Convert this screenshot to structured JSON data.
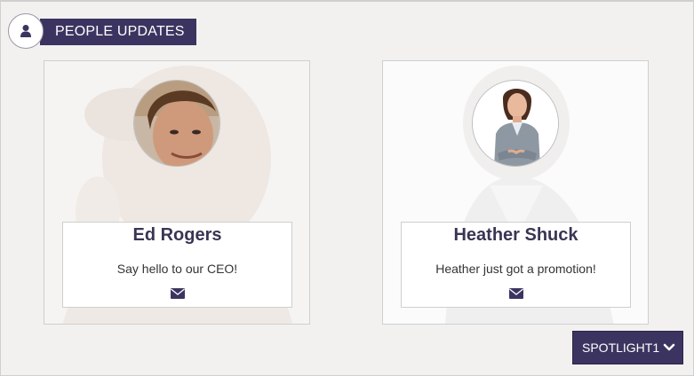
{
  "header": {
    "icon": "user-icon",
    "title": "PEOPLE UPDATES"
  },
  "cards": [
    {
      "name": "Ed Rogers",
      "message": "Say hello to our CEO!",
      "icon": "envelope-icon"
    },
    {
      "name": "Heather Shuck",
      "message": "Heather just got a promotion!",
      "icon": "envelope-icon"
    }
  ],
  "spotlight": {
    "label": "SPOTLIGHT1",
    "icon": "chevron-down-icon"
  },
  "colors": {
    "brand": "#3c3460",
    "background": "#f2f1f0"
  }
}
